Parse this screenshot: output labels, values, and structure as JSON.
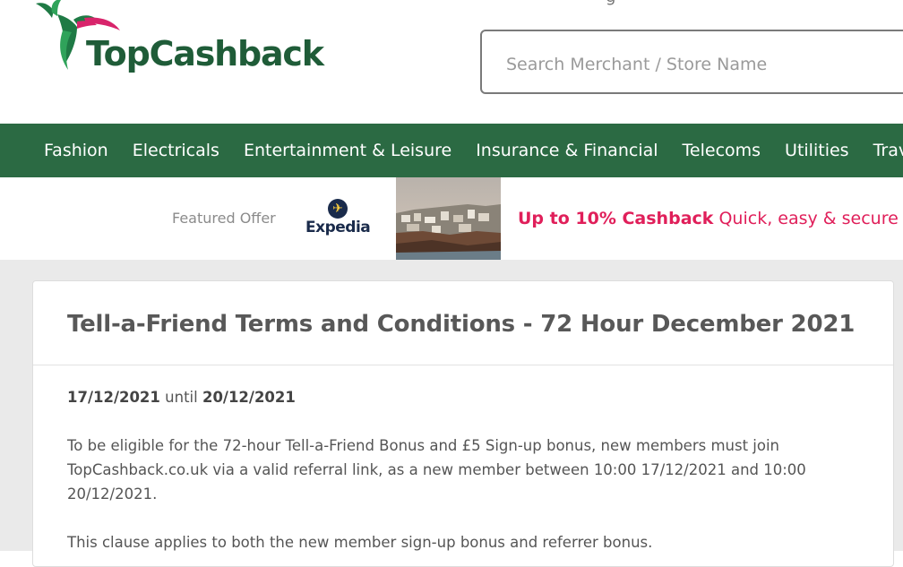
{
  "header": {
    "logo_text": "TopCashback",
    "search": {
      "placeholder": "Search Merchant / Store Name"
    }
  },
  "nav": {
    "items": [
      {
        "label": "Fashion"
      },
      {
        "label": "Electricals"
      },
      {
        "label": "Entertainment & Leisure"
      },
      {
        "label": "Insurance & Financial"
      },
      {
        "label": "Telecoms"
      },
      {
        "label": "Utilities"
      },
      {
        "label": "Trave"
      }
    ]
  },
  "featured": {
    "label": "Featured Offer",
    "merchant": "Expedia",
    "offer_bold": "Up to 10% Cashback",
    "offer_text": "Quick, easy & secure"
  },
  "article": {
    "title": "Tell-a-Friend Terms and Conditions - 72 Hour December 2021",
    "start_date": "17/12/2021",
    "until_word": "until",
    "end_date": "20/12/2021",
    "paragraph1": "To be eligible for the 72-hour Tell-a-Friend Bonus and £5 Sign-up bonus, new members must join TopCashback.co.uk via a valid referral link, as a new member between 10:00 17/12/2021 and 10:00 20/12/2021.",
    "paragraph2": "This clause applies to both the new member sign-up bonus and referrer bonus."
  },
  "colors": {
    "brand_green": "#2b6a43",
    "logo_green": "#1f5c38",
    "offer_pink": "#e01f5a"
  }
}
